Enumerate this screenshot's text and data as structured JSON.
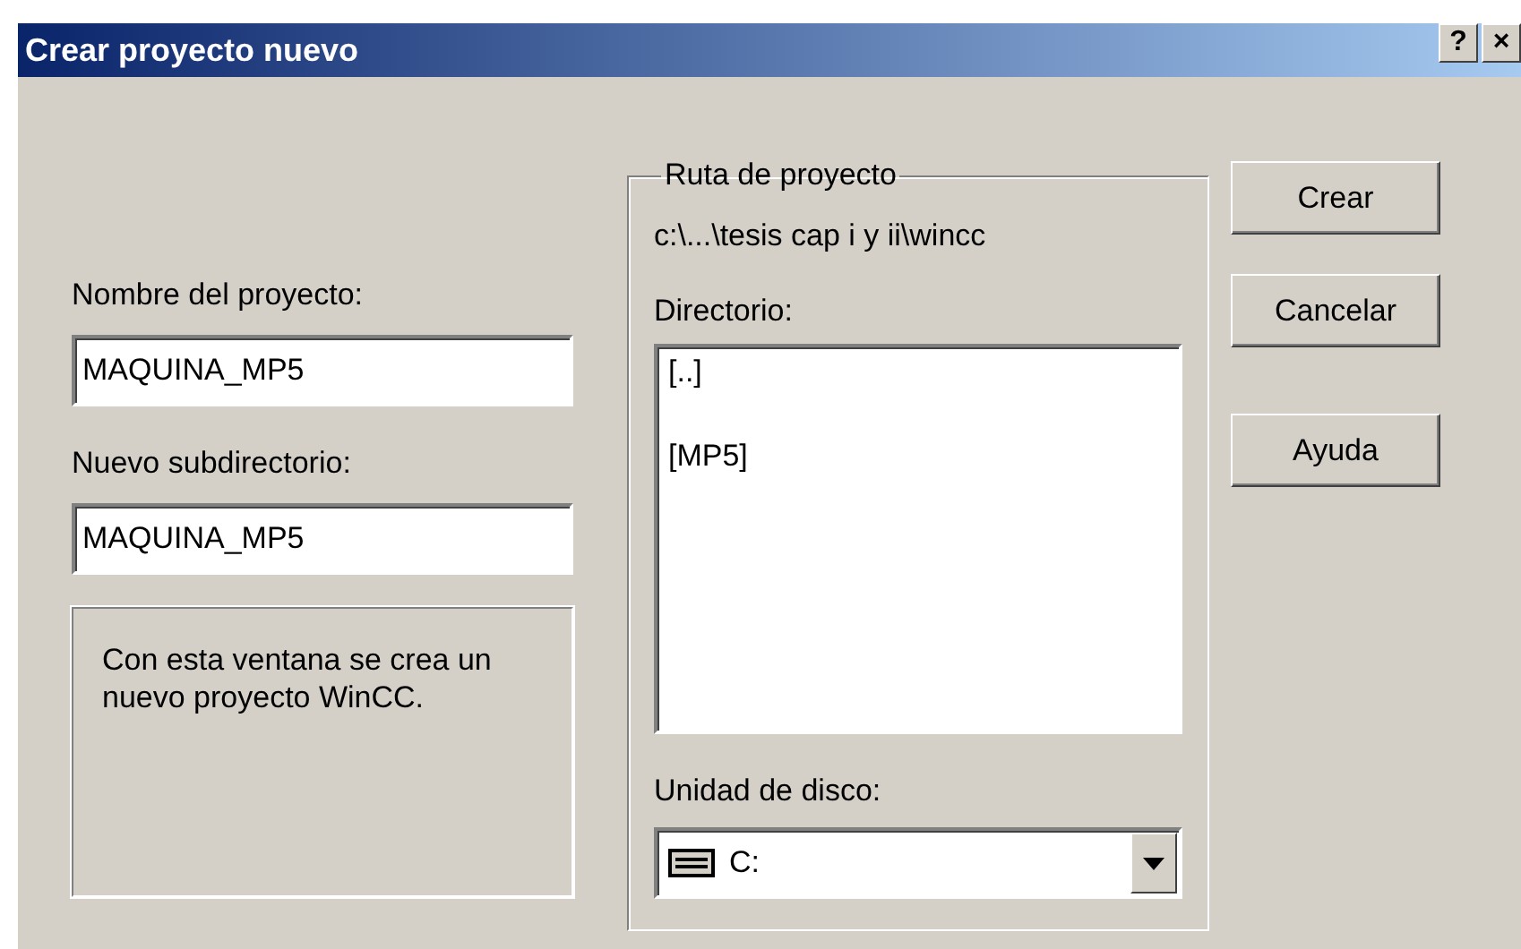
{
  "window": {
    "title": "Crear proyecto nuevo",
    "title_buttons": [
      "?",
      "×"
    ]
  },
  "project_name": {
    "label": "Nombre del proyecto:",
    "value": "MAQUINA_MP5"
  },
  "subdirectory": {
    "label": "Nuevo subdirectorio:",
    "value": "MAQUINA_MP5"
  },
  "info": "Con esta ventana se crea un nuevo proyecto WinCC.",
  "project_path": {
    "title": "Ruta de proyecto",
    "path": "c:\\...\\tesis cap i y ii\\wincc",
    "directory_label": "Directorio:",
    "directories": [
      "[..]",
      "[MP5]"
    ],
    "drive_label": "Unidad de disco:",
    "drive": "C:"
  },
  "buttons": [
    "Crear",
    "Cancelar",
    "Ayuda"
  ]
}
